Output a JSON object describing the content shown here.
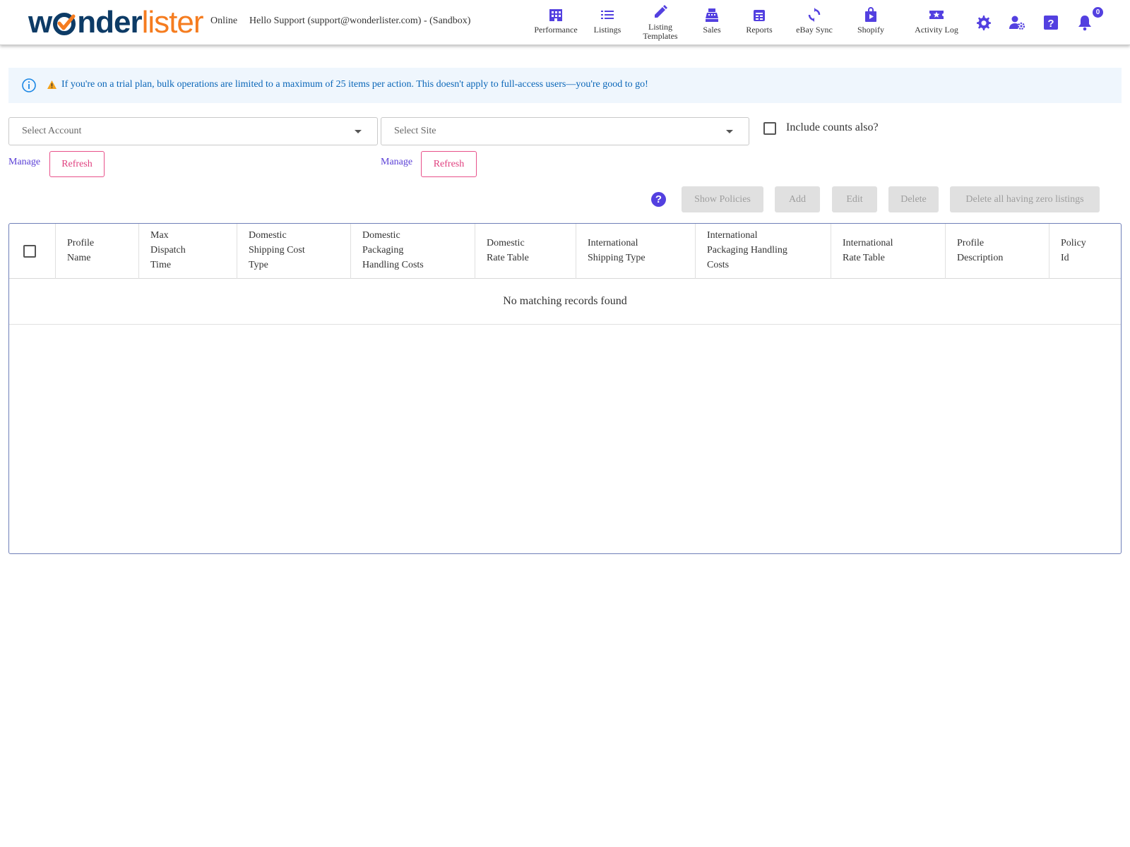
{
  "header": {
    "logo": {
      "part1": "w",
      "part2": "nder",
      "part3": "lister"
    },
    "status": "Online",
    "greeting": "Hello Support (support@wonderlister.com) - (Sandbox)",
    "nav": [
      {
        "label": "Performance",
        "icon": "building-icon"
      },
      {
        "label": "Listings",
        "icon": "list-icon"
      },
      {
        "label": "Listing\nTemplates",
        "icon": "pencil-icon"
      },
      {
        "label": "Sales",
        "icon": "cash-register-icon"
      },
      {
        "label": "Reports",
        "icon": "report-icon"
      },
      {
        "label": "eBay Sync",
        "icon": "sync-icon"
      },
      {
        "label": "Shopify",
        "icon": "shopify-bag-icon"
      },
      {
        "label": "Activity Log",
        "icon": "ticket-star-icon"
      }
    ],
    "notification_count": "0",
    "accent": "#5340e0"
  },
  "alert": {
    "text": "If you're on a trial plan, bulk operations are limited to a maximum of 25 items per action. This doesn't apply to full-access users—you're good to go!",
    "text_color": "#0a66b8",
    "background": "#eff6fd"
  },
  "filters": {
    "account_placeholder": "Select Account",
    "site_placeholder": "Select Site",
    "include_counts_label": "Include counts also?",
    "include_counts_checked": false,
    "manage_label": "Manage",
    "refresh_label": "Refresh"
  },
  "toolbar": {
    "help": "?",
    "show_policies": "Show Policies",
    "add": "Add",
    "edit": "Edit",
    "delete": "Delete",
    "delete_zero": "Delete all having zero listings"
  },
  "table": {
    "columns": [
      "Profile\nName",
      "Max\nDispatch\nTime",
      "Domestic\nShipping Cost\nType",
      "Domestic\nPackaging\nHandling Costs",
      "Domestic\nRate Table",
      "International\nShipping Type",
      "International\nPackaging Handling\nCosts",
      "International\nRate Table",
      "Profile\nDescription",
      "Policy\nId"
    ],
    "empty_message": "No matching records found"
  }
}
